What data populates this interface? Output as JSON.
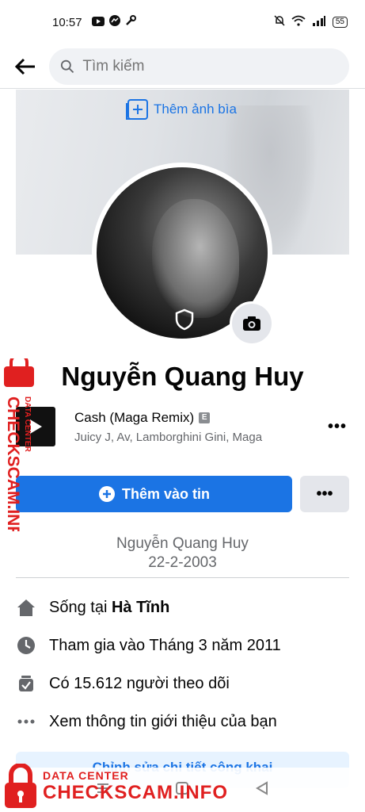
{
  "status_bar": {
    "time": "10:57",
    "left_icons": [
      "youtube-icon",
      "messenger-icon",
      "wrench-icon"
    ],
    "right_icons": [
      "mute-bell-icon",
      "wifi-icon",
      "signal-icon"
    ],
    "battery": "55"
  },
  "search": {
    "placeholder": "Tìm kiếm"
  },
  "cover": {
    "add_cover_label": "Thêm ảnh bìa"
  },
  "profile": {
    "name": "Nguyễn Quang Huy"
  },
  "music": {
    "song_title": "Cash (Maga Remix)",
    "explicit_badge": "E",
    "artists": "Juicy J, Av, Lamborghini Gini, Maga",
    "more": "•••"
  },
  "actions": {
    "add_story_label": "Thêm vào tin",
    "more_label": "•••"
  },
  "bio": {
    "line1": "Nguyễn Quang Huy",
    "line2": "22-2-2003"
  },
  "details": {
    "lives_prefix": "Sống tại ",
    "lives_place": "Hà Tĩnh",
    "joined": "Tham gia vào Tháng 3 năm 2011",
    "followers": "Có 15.612 người theo dõi",
    "about": "Xem thông tin giới thiệu của bạn"
  },
  "edit_details_label": "Chỉnh sửa chi tiết công khai",
  "watermark": {
    "small": "DATA CENTER",
    "big": "CHECKSCAM.INFO"
  },
  "colors": {
    "accent": "#1b74e4",
    "watermark": "#e02020"
  }
}
